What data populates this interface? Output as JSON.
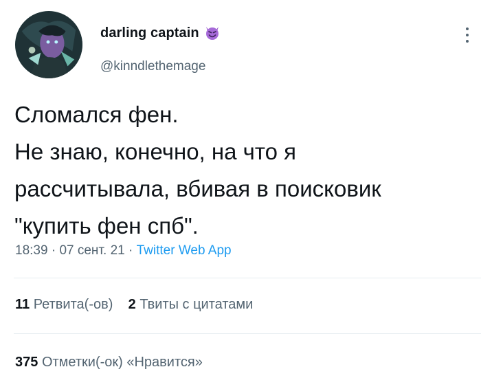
{
  "author": {
    "display_name": "darling captain",
    "handle": "@kinndlethemage",
    "avatar_icon": "fantasy-character-avatar",
    "badge_icon": "smiling-devil-emoji"
  },
  "tweet": {
    "lines": [
      "Сломался фен.",
      "Не знаю, конечно, на что я",
      "рассчитывала, вбивая в поисковик",
      "\"купить фен спб\"."
    ]
  },
  "meta": {
    "time": "18:39",
    "sep1": " · ",
    "date": "07 сент. 21",
    "sep2": " · ",
    "client": "Twitter Web App"
  },
  "stats": {
    "retweets_count": "11",
    "retweets_label": "Ретвита(-ов)",
    "quotes_count": "2",
    "quotes_label": "Твиты с цитатами",
    "likes_count": "375",
    "likes_label": "Отметки(-ок) «Нравится»"
  },
  "colors": {
    "accent": "#1d9bf0",
    "secondary_text": "#536471",
    "emoji": "#9b59d0"
  }
}
